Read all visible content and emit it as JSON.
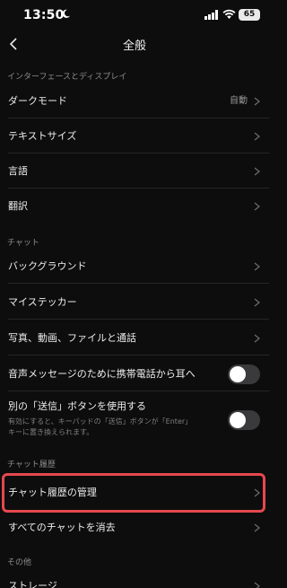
{
  "status": {
    "time": "13:50",
    "battery": "65"
  },
  "nav": {
    "title": "全般"
  },
  "sections": {
    "interface": "インターフェースとディスプレイ",
    "chat": "チャット",
    "history": "チャット履歴",
    "other": "その他"
  },
  "rows": {
    "dark_mode": {
      "label": "ダークモード",
      "value": "自動"
    },
    "text_size": {
      "label": "テキストサイズ"
    },
    "language": {
      "label": "言語"
    },
    "translate": {
      "label": "翻訳"
    },
    "background": {
      "label": "バックグラウンド"
    },
    "my_stickers": {
      "label": "マイステッカー"
    },
    "media": {
      "label": "写真、動画、ファイルと通話"
    },
    "voice_ear": {
      "label": "音声メッセージのために携帯電話から耳へ",
      "enabled": false
    },
    "send_button": {
      "label": "別の「送信」ボタンを使用する",
      "desc1": "有効にすると、キーパッドの「送信」ボタンが「Enter」",
      "desc2": "キーに置き換えられます。",
      "enabled": false
    },
    "manage_history": {
      "label": "チャット履歴の管理"
    },
    "clear_all": {
      "label": "すべてのチャットを消去"
    },
    "storage": {
      "label": "ストレージ"
    }
  },
  "colors": {
    "highlight": "#e5484d",
    "background": "#0d0d0d"
  }
}
